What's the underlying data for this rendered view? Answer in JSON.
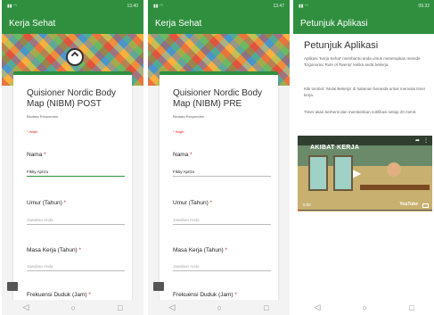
{
  "colors": {
    "primary": "#2f8f3f",
    "required": "#d93025"
  },
  "icons": {
    "back": "triangle-back-icon",
    "home": "circle-home-icon",
    "recent": "square-recent-icon",
    "wifi": "wifi-icon",
    "signal": "signal-icon"
  },
  "screens": [
    {
      "status_time": "13.40",
      "app_title": "Kerja Sehat",
      "form_title": "Quisioner Nordic Body Map (NIBM) POST",
      "form_sub": "Biodata Responden",
      "required_note": "* Wajib",
      "fields": [
        {
          "label": "Nama",
          "value": "Fikky Aprizo"
        },
        {
          "label": "Umur (Tahun)",
          "placeholder": "Jawaban Anda"
        },
        {
          "label": "Masa Kerja (Tahun)",
          "placeholder": "Jawaban Anda"
        },
        {
          "label": "Frekuensi Duduk (Jam)"
        }
      ]
    },
    {
      "status_time": "13.47",
      "app_title": "Kerja Sehat",
      "form_title": "Quisioner Nordic Body Map (NIBM) PRE",
      "form_sub": "Biodata Responden",
      "required_note": "* Wajib",
      "fields": [
        {
          "label": "Nama",
          "value": "Fikky Aprizo"
        },
        {
          "label": "Umur (Tahun)",
          "placeholder": "Jawaban Anda"
        },
        {
          "label": "Masa Kerja (Tahun)",
          "placeholder": "Jawaban Anda"
        },
        {
          "label": "Frekuensi Duduk (Jam)"
        }
      ]
    },
    {
      "status_time": "09.32",
      "app_title": "Petunjuk Aplikasi",
      "help_title": "Petunjuk Aplikasi",
      "paragraphs": [
        "Aplikasi 'Kerja Sehat' membantu anda untuk menerapkan metode 'Ergonomic Rule of Twenty' ketika anda bekerja.",
        "Klik tombol: 'Mulai Bekerja' di halaman beranda untuk memulai timer kerja.",
        "Timer akan berhenti dan memberikan notifikasi setiap 20 menit."
      ],
      "video": {
        "caption": "AKIBAT KERJA",
        "time": "0:00",
        "brand": "YouTube",
        "progress": 0.02
      }
    }
  ]
}
